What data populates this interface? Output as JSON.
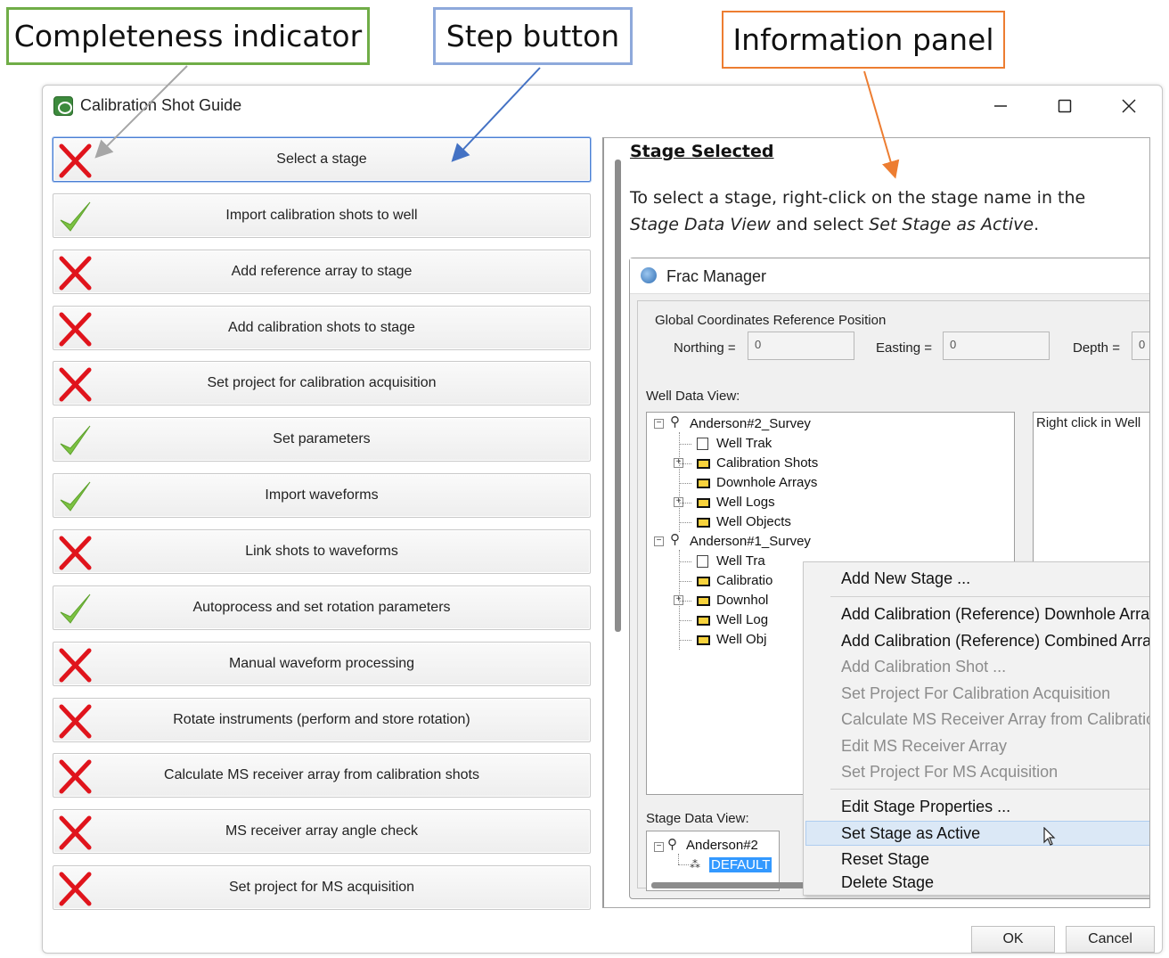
{
  "callouts": {
    "completeness": "Completeness indicator",
    "step": "Step button",
    "info": "Information panel"
  },
  "window": {
    "title": "Calibration Shot Guide",
    "icon": "app-icon",
    "controls": {
      "minimize": "–",
      "maximize": "☐",
      "close": "✕"
    }
  },
  "colors": {
    "x_mark": "#e0141c",
    "check_mark": "#7cc242",
    "callout_green": "#70ad47",
    "callout_blue": "#8ea9db",
    "callout_orange": "#ed7d31",
    "selected_border": "#4a7fd4"
  },
  "steps": [
    {
      "label": "Select a stage",
      "status": "incomplete",
      "selected": true
    },
    {
      "label": "Import calibration shots to well",
      "status": "complete"
    },
    {
      "label": "Add reference array to stage",
      "status": "incomplete"
    },
    {
      "label": "Add calibration shots to stage",
      "status": "incomplete"
    },
    {
      "label": "Set project for calibration acquisition",
      "status": "incomplete"
    },
    {
      "label": "Set parameters",
      "status": "complete"
    },
    {
      "label": "Import waveforms",
      "status": "complete"
    },
    {
      "label": "Link shots to waveforms",
      "status": "incomplete"
    },
    {
      "label": "Autoprocess and set rotation parameters",
      "status": "complete"
    },
    {
      "label": "Manual waveform processing",
      "status": "incomplete"
    },
    {
      "label": "Rotate instruments (perform and store rotation)",
      "status": "incomplete"
    },
    {
      "label": "Calculate MS receiver array from calibration shots",
      "status": "incomplete"
    },
    {
      "label": "MS receiver array angle check",
      "status": "incomplete"
    },
    {
      "label": "Set project for MS acquisition",
      "status": "incomplete"
    }
  ],
  "info": {
    "heading": "Stage Selected",
    "text_1": "To select a stage, right-click on the stage name in the ",
    "text_em_1": "Stage Data View",
    "text_2": " and select ",
    "text_em_2": "Set Stage as Active",
    "text_3": "."
  },
  "frac": {
    "title": "Frac Manager",
    "group_label": "Global Coordinates Reference Position",
    "northing_label": "Northing =",
    "northing_value": "0",
    "easting_label": "Easting =",
    "easting_value": "0",
    "depth_label": "Depth =",
    "depth_value": "0",
    "well_data_view_label": "Well Data View:",
    "right_box_text": "Right click in Well",
    "tree": [
      {
        "label": "Anderson#2_Survey",
        "type": "rig"
      },
      {
        "label": "Well Trak",
        "type": "doc"
      },
      {
        "label": "Calibration Shots",
        "type": "folder"
      },
      {
        "label": "Downhole Arrays",
        "type": "folder"
      },
      {
        "label": "Well Logs",
        "type": "folder"
      },
      {
        "label": "Well Objects",
        "type": "folder"
      },
      {
        "label": "Anderson#1_Survey",
        "type": "rig"
      },
      {
        "label": "Well Tra",
        "type": "doc"
      },
      {
        "label": "Calibratio",
        "type": "folder"
      },
      {
        "label": "Downhol",
        "type": "folder"
      },
      {
        "label": "Well Log",
        "type": "folder"
      },
      {
        "label": "Well Obj",
        "type": "folder"
      }
    ],
    "stage_data_view_label": "Stage Data View:",
    "stage_tree": [
      {
        "label": "Anderson#2"
      },
      {
        "label": "DEFAULT"
      }
    ]
  },
  "context_menu": [
    {
      "label": "Add New Stage ...",
      "enabled": true
    },
    {
      "label": "Add Calibration (Reference) Downhole Array ...",
      "enabled": true
    },
    {
      "label": "Add Calibration (Reference) Combined Array ...",
      "enabled": true
    },
    {
      "label": "Add Calibration Shot ...",
      "enabled": false
    },
    {
      "label": "Set Project For Calibration Acquisition",
      "enabled": false
    },
    {
      "label": "Calculate MS Receiver Array from Calibration Shots",
      "enabled": false
    },
    {
      "label": "Edit MS Receiver Array",
      "enabled": false
    },
    {
      "label": "Set Project For MS Acquisition",
      "enabled": false
    },
    {
      "label": "Edit Stage Properties ...",
      "enabled": true
    },
    {
      "label": "Set Stage as Active",
      "enabled": true,
      "hover": true
    },
    {
      "label": "Reset Stage",
      "enabled": true
    },
    {
      "label": "Delete Stage",
      "enabled": true
    }
  ],
  "buttons": {
    "ok": "OK",
    "cancel": "Cancel"
  }
}
